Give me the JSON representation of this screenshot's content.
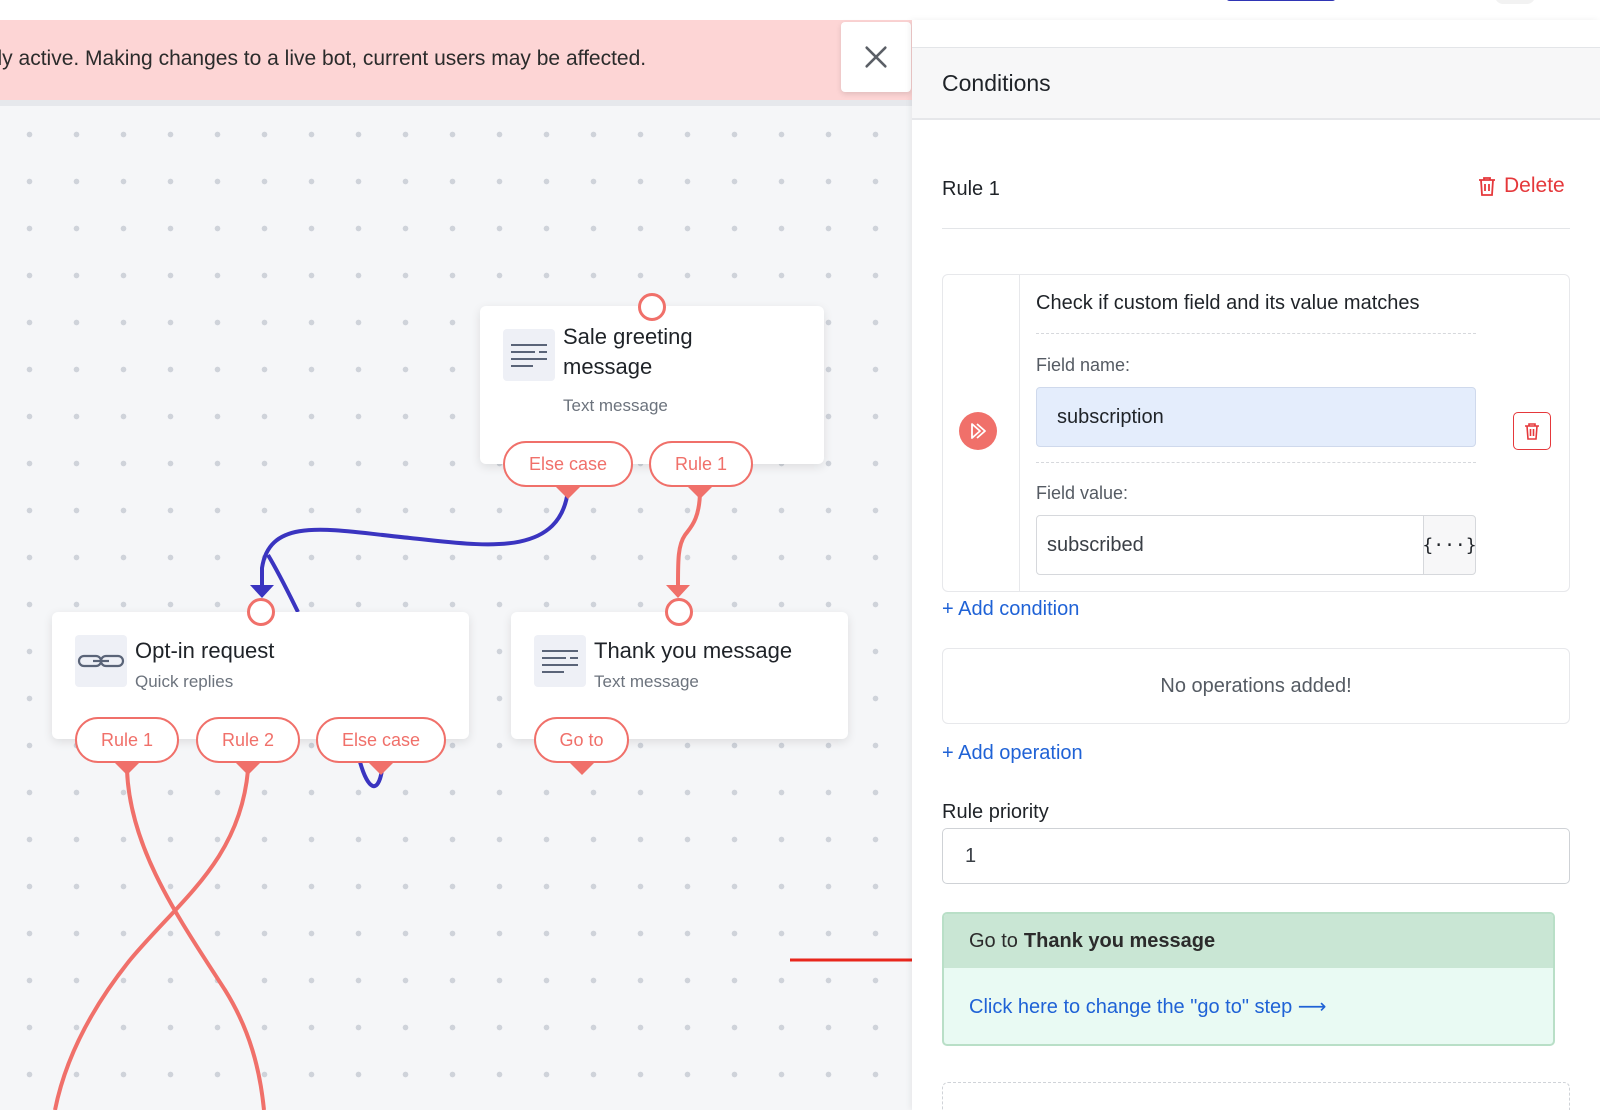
{
  "banner": {
    "text": "ntly active. Making changes to a live bot, current users may be affected.",
    "close_icon": "close-icon"
  },
  "canvas": {
    "nodes": {
      "sale": {
        "title_line1": "Sale greeting",
        "title_line2": "message",
        "subtitle": "Text message",
        "icon": "text-lines-icon"
      },
      "optin": {
        "title": "Opt-in request",
        "subtitle": "Quick replies",
        "icon": "link-chain-icon"
      },
      "thanks": {
        "title": "Thank you message",
        "subtitle": "Text message",
        "icon": "text-lines-icon"
      }
    },
    "chips": {
      "sale_else": "Else case",
      "sale_rule1": "Rule 1",
      "optin_rule1": "Rule 1",
      "optin_rule2": "Rule 2",
      "optin_else": "Else case",
      "thanks_goto": "Go to"
    },
    "colors": {
      "flow_red": "#f0706a",
      "flow_blue": "#3a34c0"
    }
  },
  "panel": {
    "title": "Conditions",
    "rule_label": "Rule 1",
    "delete_label": "Delete",
    "condition": {
      "heading": "Check if custom field and its value matches",
      "field_name_label": "Field name:",
      "field_name_value": "subscription",
      "field_value_label": "Field value:",
      "field_value_value": "subscribed",
      "variable_button": "{···}"
    },
    "add_condition": "+ Add condition",
    "ops_empty": "No operations added!",
    "add_operation": "+ Add operation",
    "priority_label": "Rule priority",
    "priority_value": "1",
    "goto": {
      "prefix": "Go to",
      "target": "Thank you message",
      "change_link": "Click here to change the \"go to\" step ⟶"
    },
    "colors": {
      "accent_link": "#1f62d6",
      "danger": "#e5383b",
      "goto_header": "#c9e6d4",
      "goto_body": "#e9faf3"
    }
  }
}
